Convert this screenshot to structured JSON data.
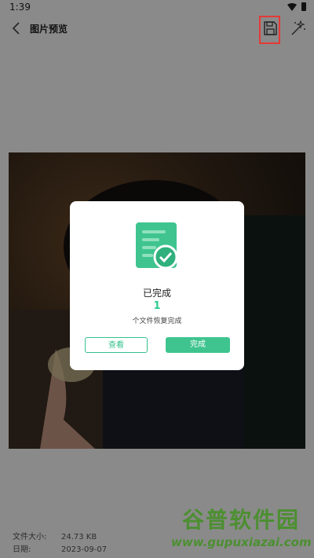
{
  "status_bar": {
    "time": "1:39"
  },
  "toolbar": {
    "title": "图片预览"
  },
  "icons": {
    "back": "chevron-left-icon",
    "save": "save-icon",
    "magic": "magic-wand-icon",
    "wifi": "wifi-icon",
    "battery": "battery-icon",
    "success": "document-check-icon"
  },
  "file_info": {
    "size_label": "文件大小:",
    "size_value": "24.73 KB",
    "date_label": "日期:",
    "date_value": "2023-09-07"
  },
  "dialog": {
    "title": "已完成",
    "count": "1",
    "description": "个文件恢复完成",
    "view_button": "查看",
    "done_button": "完成"
  },
  "watermark": {
    "title": "谷普软件园",
    "url": "www.gupuxiazai.com"
  },
  "colors": {
    "accent": "#3fc48f",
    "highlight": "#e53935",
    "watermark": "#4c8f31"
  }
}
